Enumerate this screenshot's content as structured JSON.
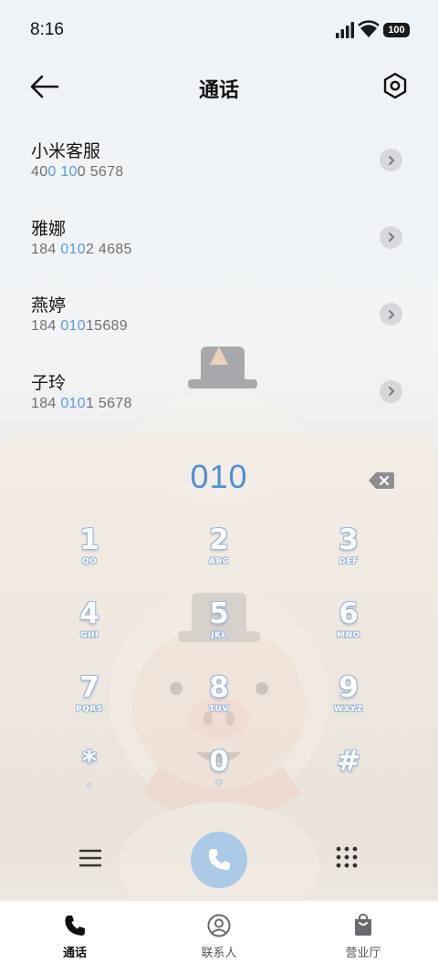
{
  "status_bar": {
    "time": "8:16",
    "battery": "100"
  },
  "header": {
    "title": "通话"
  },
  "contacts": [
    {
      "name": "小米客服",
      "num_pre": "40",
      "num_hl_1": "0",
      "num_mid": " ",
      "num_hl_2": "10",
      "num_post": "0 5678"
    },
    {
      "name": "雅娜",
      "num_pre": "184 ",
      "num_hl_1": "010",
      "num_mid": "",
      "num_hl_2": "",
      "num_post": "2 4685"
    },
    {
      "name": "燕婷",
      "num_pre": "184 ",
      "num_hl_1": "010",
      "num_mid": "",
      "num_hl_2": "",
      "num_post": "15689"
    },
    {
      "name": "子玲",
      "num_pre": "184 ",
      "num_hl_1": "010",
      "num_mid": "",
      "num_hl_2": "",
      "num_post": "1 5678"
    }
  ],
  "dialer": {
    "display": "010",
    "keys": [
      {
        "digit": "1",
        "letters": "QO"
      },
      {
        "digit": "2",
        "letters": "ABC"
      },
      {
        "digit": "3",
        "letters": "DEF"
      },
      {
        "digit": "4",
        "letters": "GHI"
      },
      {
        "digit": "5",
        "letters": "JKL"
      },
      {
        "digit": "6",
        "letters": "MNO"
      },
      {
        "digit": "7",
        "letters": "PQRS"
      },
      {
        "digit": "8",
        "letters": "TUV"
      },
      {
        "digit": "9",
        "letters": "WXYZ"
      },
      {
        "digit": "*",
        "letters": ","
      },
      {
        "digit": "0",
        "letters": "+"
      },
      {
        "digit": "#",
        "letters": ""
      }
    ]
  },
  "bottom_nav": [
    {
      "label": "通话",
      "icon": "phone-icon",
      "active": true
    },
    {
      "label": "联系人",
      "icon": "person-icon",
      "active": false
    },
    {
      "label": "营业厅",
      "icon": "bag-icon",
      "active": false
    }
  ],
  "colors": {
    "accent": "#4d90dc",
    "highlight": "#5a9be0",
    "call_button": "#a0c3e8"
  }
}
